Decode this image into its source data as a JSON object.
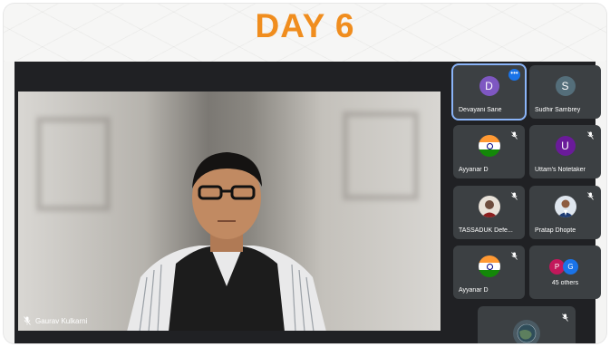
{
  "banner": {
    "title": "DAY 6"
  },
  "main_video": {
    "participant_name": "Gaurav Kulkarni"
  },
  "participants": [
    {
      "name": "Devayani Sane",
      "initial": "D",
      "avatar_color": "#7e57c2",
      "active": true,
      "has_more_menu": true
    },
    {
      "name": "Sudhir Sambrey",
      "initial": "S",
      "avatar_color": "#546e7a",
      "muted": false
    },
    {
      "name": "Ayyanar D",
      "avatar_type": "india-flag",
      "muted": true
    },
    {
      "name": "Uttam's Notetaker",
      "initial": "U",
      "avatar_color": "#6a1b9a",
      "muted": true
    },
    {
      "name": "TASSADUK Defe...",
      "avatar_type": "photo",
      "muted": true
    },
    {
      "name": "Pratap Dhopte",
      "avatar_type": "photo",
      "muted": true
    },
    {
      "name": "Ayyanar D",
      "avatar_type": "india-flag",
      "muted": true
    },
    {
      "name": "45 others",
      "group_initials": [
        "P",
        "G"
      ],
      "group_colors": [
        "#c2185b",
        "#1a73e8"
      ]
    }
  ],
  "more_menu_glyph": "•••",
  "colors": {
    "accent_orange": "#f08d1e",
    "meet_bg": "#202124",
    "tile_bg": "#3c4043",
    "active_border": "#8ab4f8"
  }
}
